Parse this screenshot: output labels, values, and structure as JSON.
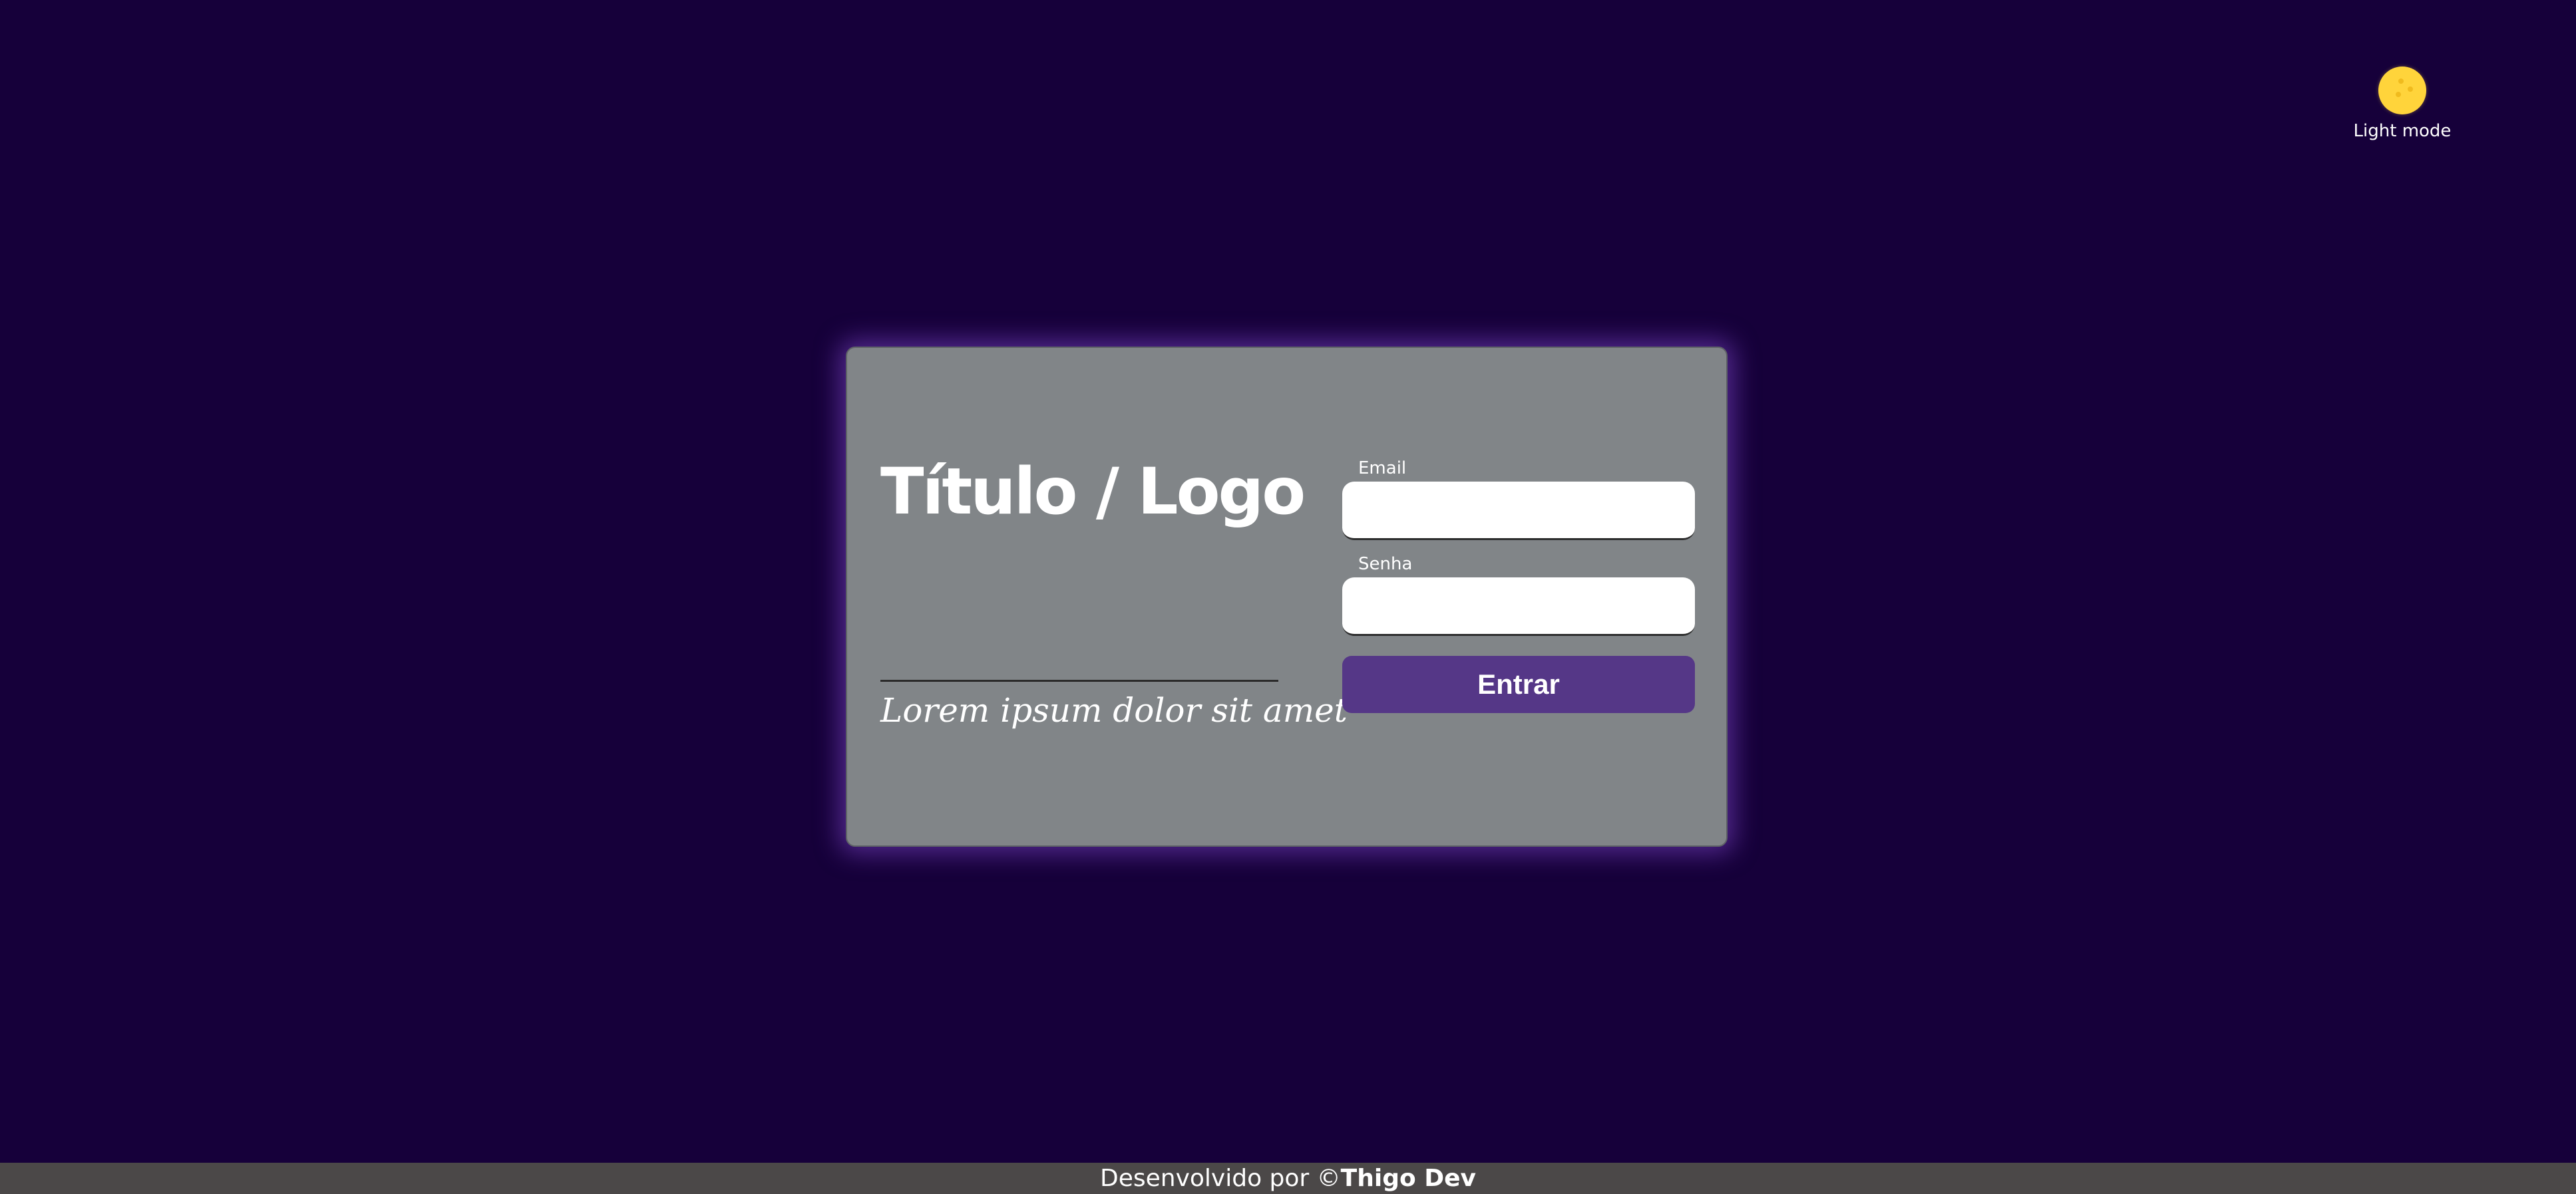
{
  "theme_toggle": {
    "label": "Light mode",
    "icon": "sun-icon"
  },
  "brand": {
    "title": "Título / Logo",
    "tagline": "Lorem ipsum dolor sit amet"
  },
  "form": {
    "email_label": "Email",
    "email_value": "",
    "password_label": "Senha",
    "password_value": "",
    "submit_label": "Entrar"
  },
  "footer": {
    "prefix": "Desenvolvido por ©",
    "author": "Thigo Dev"
  },
  "colors": {
    "background": "#16003a",
    "card": "#818588",
    "card_glow": "#8448d0",
    "accent": "#553787",
    "sun": "#ffd43b",
    "footer": "#4b4848"
  }
}
